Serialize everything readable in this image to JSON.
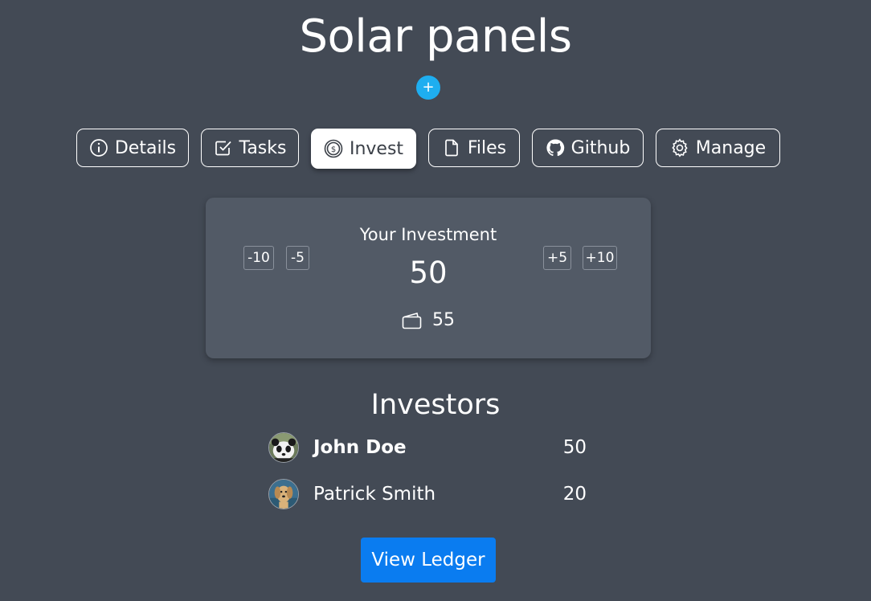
{
  "project": {
    "title": "Solar panels",
    "add_label": "+"
  },
  "tabs": [
    {
      "label": "Details",
      "icon": "info-circle-icon"
    },
    {
      "label": "Tasks",
      "icon": "check-square-icon"
    },
    {
      "label": "Invest",
      "icon": "coin-dollar-icon",
      "active": true
    },
    {
      "label": "Files",
      "icon": "file-icon"
    },
    {
      "label": "Github",
      "icon": "github-icon"
    },
    {
      "label": "Manage",
      "icon": "gear-icon"
    }
  ],
  "investment": {
    "label": "Your Investment",
    "value": "50",
    "wallet_balance": "55",
    "buttons": {
      "minus10": "-10",
      "minus5": "-5",
      "plus5": "+5",
      "plus10": "+10"
    }
  },
  "investors": {
    "title": "Investors",
    "list": [
      {
        "name": "John Doe",
        "amount": "50",
        "avatar": "panda-avatar"
      },
      {
        "name": "Patrick Smith",
        "amount": "20",
        "avatar": "dog-avatar"
      }
    ]
  },
  "ledger": {
    "label": "View Ledger"
  },
  "colors": {
    "background": "#434a55",
    "card": "#525a66",
    "accent_add": "#1eaef0",
    "primary_button": "#0a7cf0"
  }
}
